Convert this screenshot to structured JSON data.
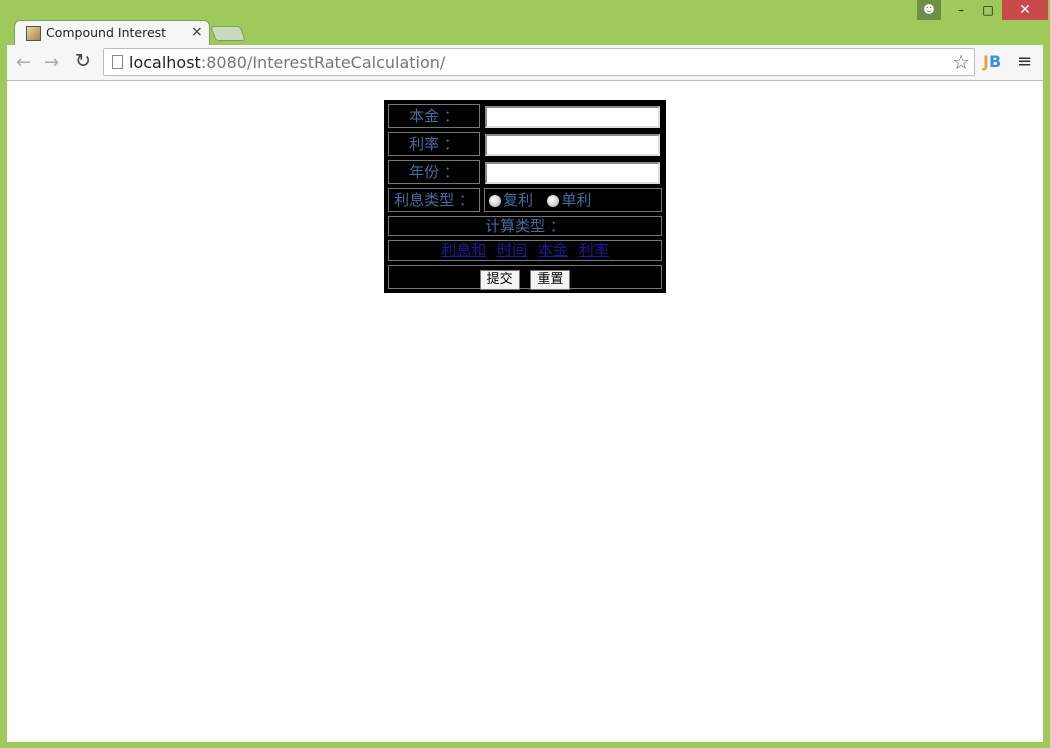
{
  "window": {
    "user_icon": "user-icon",
    "minimize": "minimize-icon",
    "maximize": "maximize-icon",
    "close": "close-icon"
  },
  "tab": {
    "title": "Compound Interest",
    "close_glyph": "×"
  },
  "toolbar": {
    "back_glyph": "←",
    "forward_glyph": "→",
    "reload_glyph": "↻",
    "url_host": "localhost",
    "url_rest": ":8080/InterestRateCalculation/",
    "star_glyph": "☆",
    "ext_j": "J",
    "ext_b": "B",
    "menu_glyph": "≡"
  },
  "form": {
    "principal_label": "本金 ：",
    "principal_value": "",
    "rate_label": "利率 ：",
    "rate_value": "",
    "years_label": "年份 ：",
    "years_value": "",
    "interest_type_label": "利息类型 ：",
    "interest_type_options": [
      "复利",
      "单利"
    ],
    "calc_type_label": "计算类型 ：",
    "calc_links": [
      "利息和",
      "时间",
      "本金",
      "利率"
    ],
    "submit_label": "提交",
    "reset_label": "重置"
  }
}
